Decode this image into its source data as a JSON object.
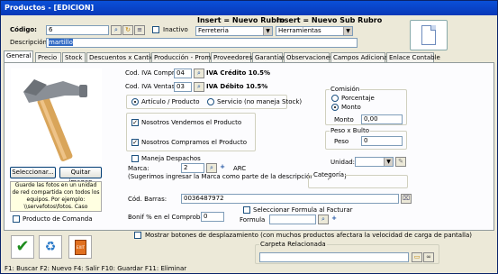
{
  "window": {
    "title": "Productos - [EDICION]"
  },
  "header": {
    "codigo_label": "Código:",
    "codigo_value": "6",
    "inactivo_label": "Inactivo",
    "insert_rubro_label": "Insert = Nuevo Rubro",
    "insert_subrubro_label": "Insert = Nuevo Sub Rubro",
    "rubro_value": "Ferreteria",
    "subrubro_value": "Herramientas",
    "descripcion_label": "Descripción:",
    "descripcion_value": "martillo"
  },
  "tabs": [
    {
      "label": "General"
    },
    {
      "label": "Precio"
    },
    {
      "label": "Stock"
    },
    {
      "label": "Descuentos x Cantidad"
    },
    {
      "label": "Producción - Promos"
    },
    {
      "label": "Proveedores"
    },
    {
      "label": "Garantías"
    },
    {
      "label": "Observaciones"
    },
    {
      "label": "Campos Adicionales"
    },
    {
      "label": "Enlace Contable"
    }
  ],
  "general": {
    "seleccionar_label": "Seleccionar...",
    "quitar_label": "Quitar imagen",
    "image_note": "Guarde las fotos en un unidad de red compartida con todos los equipos. Por ejemplo: \\\\servefotos\\fotos. Caso contrario no vera las fotos desde otra Pc",
    "producto_comanda_label": "Producto de Comanda",
    "iva_compras_label": "Cod. IVA Compras",
    "iva_compras_value": "04",
    "iva_credito_label": "IVA Crédito 10.5%",
    "iva_ventas_label": "Cod. IVA Ventas:",
    "iva_ventas_value": "03",
    "iva_debito_label": "IVA Débito 10.5%",
    "tipo_articulo_label": "Artículo / Producto",
    "tipo_servicio_label": "Servicio (no maneja Stock)",
    "vendemos_label": "Nosotros Vendemos el Producto",
    "compramos_label": "Nosotros Compramos el Producto",
    "maneja_despachos_label": "Maneja Despachos",
    "marca_label": "Marca:",
    "marca_value": "2",
    "marca_text": "ARC",
    "marca_hint": "(Sugerimos ingresar la Marca como parte de la descripción del prod.)",
    "cod_barras_label": "Cód. Barras:",
    "cod_barras_value": "0036487972",
    "bonif_label": "Bonif % en el Comprobante",
    "bonif_value": "0",
    "comision_title": "Comisión",
    "porcentaje_label": "Porcentaje",
    "monto_radio_label": "Monto",
    "monto_label": "Monto",
    "monto_value": "0,00",
    "peso_title": "Peso x Bulto",
    "peso_label": "Peso",
    "peso_value": "0",
    "unidad_label": "Unidad:",
    "categoria_title": "Categoría",
    "formula_check_label": "Seleccionar Formula al Facturar",
    "formula_label": "Formula"
  },
  "footer": {
    "desplazamiento_label": "Mostrar botones de desplazamiento  (con muchos productos afectara la velocidad de carga de pantalla)",
    "carpeta_title": "Carpeta Relacionada",
    "shortcuts": "F1: Buscar  F2: Nuevo  F4: Salir  F10: Guardar  F11: Eliminar"
  }
}
